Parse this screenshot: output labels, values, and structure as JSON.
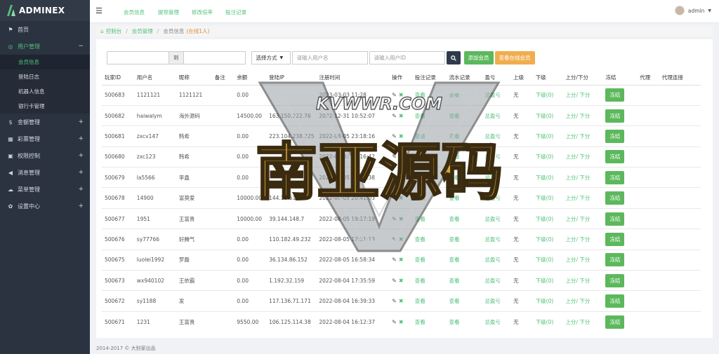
{
  "app": {
    "logo_text": "ADMINEX"
  },
  "sidebar": {
    "items": [
      {
        "label": "首页",
        "icon": "flag-icon",
        "open": false
      },
      {
        "label": "用户管理",
        "icon": "globe-icon",
        "open": true,
        "sub": [
          {
            "label": "会员信息",
            "active": true
          },
          {
            "label": "登陆日志",
            "active": false
          },
          {
            "label": "机器人信息",
            "active": false
          },
          {
            "label": "银行卡管理",
            "active": false
          }
        ]
      },
      {
        "label": "金额管理",
        "icon": "dollar-icon",
        "open": false
      },
      {
        "label": "彩票管理",
        "icon": "grid-icon",
        "open": false
      },
      {
        "label": "权限控制",
        "icon": "lock-icon",
        "open": false
      },
      {
        "label": "消息管理",
        "icon": "megaphone-icon",
        "open": false
      },
      {
        "label": "菜单管理",
        "icon": "cloud-icon",
        "open": false
      },
      {
        "label": "设置中心",
        "icon": "gear-icon",
        "open": false
      }
    ]
  },
  "topbar": {
    "links": [
      "会员信息",
      "提现管理",
      "修改倍率",
      "投注记录"
    ],
    "user": "admin"
  },
  "breadcrumb": {
    "home": "控制台",
    "section": "会员管理",
    "current": "会员信息",
    "online": "(在线1人)"
  },
  "filters": {
    "to_label": "到",
    "select_value": "选择方式",
    "user_placeholder": "请输入用户名",
    "id_placeholder": "请输入用户ID",
    "add_button": "添加会员",
    "online_button": "查看在线会员"
  },
  "table": {
    "headers": [
      "玩家ID",
      "用户名",
      "昵称",
      "备注",
      "余额",
      "登陆IP",
      "注册时间",
      "操作",
      "投注记录",
      "流水记录",
      "盈亏",
      "上级",
      "下级",
      "上分/下分",
      "冻结",
      "代理",
      "代理连接"
    ],
    "link_texts": {
      "view": "查看",
      "pnl": "总盈亏",
      "sub": "下级(0)",
      "up": "上分",
      "down": "下分",
      "freeze": "冻结",
      "none": "无"
    },
    "rows": [
      {
        "id": "500683",
        "username": "1121121",
        "nickname": "1121121",
        "balance": "0.00",
        "ip": "",
        "reg": "2023-03-03 11:28"
      },
      {
        "id": "500682",
        "username": "haiwalym",
        "nickname": "海外源码",
        "balance": "14500.00",
        "ip": "163.150.222.76",
        "reg": "2022-12-31 10:52:07"
      },
      {
        "id": "500681",
        "username": "zxcv147",
        "nickname": "韩希",
        "balance": "0.00",
        "ip": "223.104.238.225",
        "reg": "2022-08-05 23:18:16"
      },
      {
        "id": "500680",
        "username": "zxc123",
        "nickname": "韩希",
        "balance": "0.00",
        "ip": "",
        "reg": "2022-08-05 23:16:42"
      },
      {
        "id": "500679",
        "username": "la5566",
        "nickname": "李鑫",
        "balance": "0.00",
        "ip": "",
        "reg": "2022-08-05 22:43:38"
      },
      {
        "id": "500678",
        "username": "14900",
        "nickname": "富莫爱",
        "balance": "10000.00",
        "ip": "144.12.61.27",
        "reg": "2022-08-05 20:41:03"
      },
      {
        "id": "500677",
        "username": "1951",
        "nickname": "王富贵",
        "balance": "10000.00",
        "ip": "39.144.148.7",
        "reg": "2022-08-05 19:17:19"
      },
      {
        "id": "500676",
        "username": "sy77766",
        "nickname": "好腾气",
        "balance": "0.00",
        "ip": "110.182.49.232",
        "reg": "2022-08-05 17:31:13"
      },
      {
        "id": "500675",
        "username": "luolei1992",
        "nickname": "罗磊",
        "balance": "0.00",
        "ip": "36.134.86.152",
        "reg": "2022-08-05 16:58:34"
      },
      {
        "id": "500673",
        "username": "wx940102",
        "nickname": "王依霸",
        "balance": "0.00",
        "ip": "1.192.32.159",
        "reg": "2022-08-04 17:35:59"
      },
      {
        "id": "500672",
        "username": "sy1188",
        "nickname": "发",
        "balance": "0.00",
        "ip": "117.136.71.171",
        "reg": "2022-08-04 16:39:33"
      },
      {
        "id": "500671",
        "username": "1231",
        "nickname": "王富贵",
        "balance": "9550.00",
        "ip": "106.125.114.38",
        "reg": "2022-08-04 16:12:37"
      }
    ]
  },
  "watermark": {
    "top": "KVWWR.COM",
    "main": "南亚源码"
  },
  "footer": {
    "text": "2014-2017 © 大别家出品"
  },
  "colors": {
    "accent": "#4fc07a",
    "sidebar": "#2b3240",
    "add_button": "#5cb85c",
    "online_button": "#f0ad4e",
    "search_button": "#2f3b4c"
  }
}
